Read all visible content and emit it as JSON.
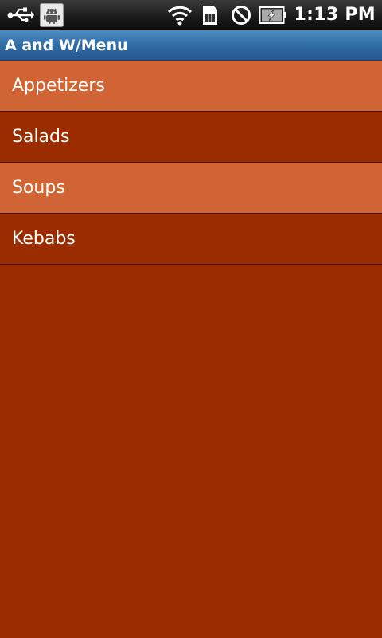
{
  "status_bar": {
    "time": "1:13 PM",
    "icons": [
      "usb-icon",
      "android-debug-icon",
      "wifi-icon",
      "sim-card-icon",
      "no-signal-icon",
      "battery-charging-icon"
    ]
  },
  "title_bar": {
    "title": "A and W/Menu",
    "color": "#2f6aa3"
  },
  "menu": {
    "items": [
      {
        "label": "Appetizers",
        "color": "#d06434"
      },
      {
        "label": "Salads",
        "color": "#9b2c00"
      },
      {
        "label": "Soups",
        "color": "#d06434"
      },
      {
        "label": "Kebabs",
        "color": "#9b2c00"
      }
    ]
  },
  "background_color": "#9b2c00"
}
